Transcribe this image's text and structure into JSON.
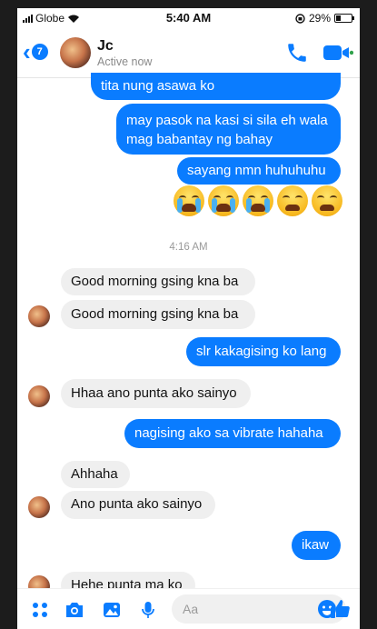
{
  "status_bar": {
    "carrier": "Globe",
    "time": "5:40 AM",
    "battery": "29%"
  },
  "header": {
    "back_count": "7",
    "contact_name": "Jc",
    "presence": "Active now"
  },
  "messages": [
    {
      "dir": "out",
      "text": "tita nung asawa ko"
    },
    {
      "dir": "out",
      "text": "may pasok na kasi si sila eh wala"
    },
    {
      "dir": "out",
      "text": "mag babantay ng bahay"
    },
    {
      "dir": "out",
      "text": "sayang nmn huhuhuhu"
    },
    {
      "dir": "in",
      "text": "Good morning gsing kna ba"
    },
    {
      "dir": "in",
      "text": "Good morning gsing kna ba"
    },
    {
      "dir": "out",
      "text": "slr kakagising ko lang"
    },
    {
      "dir": "in",
      "text": "Hhaa ano punta ako sainyo"
    },
    {
      "dir": "out",
      "text": "nagising ako sa vibrate hahaha"
    },
    {
      "dir": "in",
      "text": "Ahhaha"
    },
    {
      "dir": "in",
      "text": "Ano punta ako sainyo"
    },
    {
      "dir": "out",
      "text": "ikaw"
    },
    {
      "dir": "in",
      "text": "Hehe punta ma ko"
    }
  ],
  "timestamp": "4:16 AM",
  "reaction_emojis": [
    "loudly-crying-face",
    "loudly-crying-face",
    "loudly-crying-face",
    "tired-face",
    "tired-face"
  ],
  "composer": {
    "placeholder": "Aa"
  },
  "colors": {
    "accent": "#0a7cff",
    "incoming_bubble": "#efefef",
    "like": "#0a7cff"
  }
}
